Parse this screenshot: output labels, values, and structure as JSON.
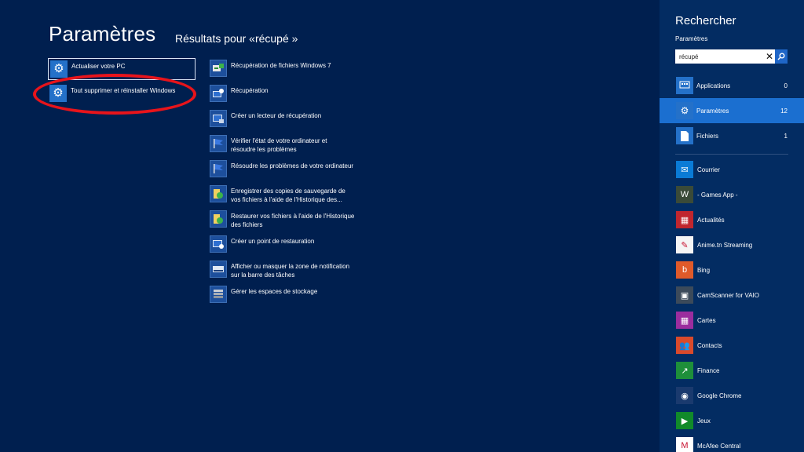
{
  "main": {
    "title": "Paramètres",
    "subtitle": "Résultats pour «récupé »",
    "settings_results": [
      {
        "label": "Actualiser votre PC"
      },
      {
        "label": "Tout supprimer et réinstaller Windows"
      }
    ],
    "control_panel_results": [
      {
        "line1": "Récupération de fichiers Windows 7",
        "line2": ""
      },
      {
        "line1": "Récupération",
        "line2": ""
      },
      {
        "line1": "Créer un lecteur de récupération",
        "line2": ""
      },
      {
        "line1": "Vérifier l'état de votre ordinateur et",
        "line2": "résoudre les problèmes"
      },
      {
        "line1": "Résoudre les problèmes de votre ordinateur",
        "line2": ""
      },
      {
        "line1": "Enregistrer des copies de sauvegarde de",
        "line2": "vos fichiers à l'aide de l'Historique des..."
      },
      {
        "line1": "Restaurer vos fichiers à l'aide de l'Historique",
        "line2": "des fichiers"
      },
      {
        "line1": "Créer un point de restauration",
        "line2": ""
      },
      {
        "line1": "Afficher ou masquer la zone de notification",
        "line2": "sur la barre des tâches"
      },
      {
        "line1": "Gérer les espaces de stockage",
        "line2": ""
      }
    ]
  },
  "charm": {
    "title": "Rechercher",
    "scope": "Paramètres",
    "search": {
      "value": "récupé",
      "clear": "✕",
      "go": "⚲"
    },
    "categories": [
      {
        "label": "Applications",
        "count": "0",
        "icon": "⊞"
      },
      {
        "label": "Paramètres",
        "count": "12",
        "icon": "⚙"
      },
      {
        "label": "Fichiers",
        "count": "1",
        "icon": "▤"
      }
    ],
    "apps": [
      {
        "label": "Courrier",
        "icon": "✉",
        "color": "#0a7bd6"
      },
      {
        "label": "- Games App -",
        "icon": "W",
        "color": "#3a4a38"
      },
      {
        "label": "Actualités",
        "icon": "▦",
        "color": "#c0262e"
      },
      {
        "label": "Anime.tn Streaming",
        "icon": "✎",
        "color": "#f5f5f5"
      },
      {
        "label": "Bing",
        "icon": "b",
        "color": "#e05a2a"
      },
      {
        "label": "CamScanner for VAIO",
        "icon": "▣",
        "color": "#3c4a5a"
      },
      {
        "label": "Cartes",
        "icon": "▦",
        "color": "#9b2d9e"
      },
      {
        "label": "Contacts",
        "icon": "👥",
        "color": "#d94a2c"
      },
      {
        "label": "Finance",
        "icon": "↗",
        "color": "#1e8f3a"
      },
      {
        "label": "Google Chrome",
        "icon": "◉",
        "color": "#1a3a6e"
      },
      {
        "label": "Jeux",
        "icon": "▶",
        "color": "#118a2a"
      },
      {
        "label": "McAfee Central",
        "icon": "M",
        "color": "#ffffff"
      }
    ]
  }
}
